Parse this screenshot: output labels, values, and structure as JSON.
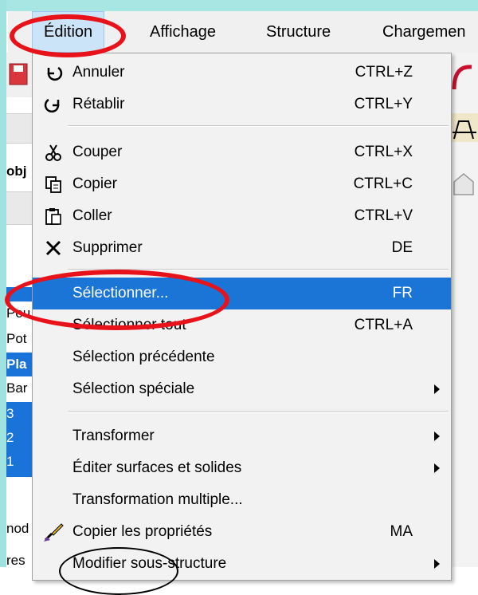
{
  "menubar": {
    "items": [
      {
        "label": "Édition"
      },
      {
        "label": "Affichage"
      },
      {
        "label": "Structure"
      },
      {
        "label": "Chargemen"
      }
    ]
  },
  "left_panel": {
    "labels": [
      "obj",
      "Pou",
      "Pot",
      "Pla",
      "Bar",
      "3",
      "2",
      "1",
      "nod",
      "res"
    ]
  },
  "menu": {
    "items": [
      {
        "label": "Annuler",
        "shortcut": "CTRL+Z",
        "icon": "undo-icon"
      },
      {
        "label": "Rétablir",
        "shortcut": "CTRL+Y",
        "icon": "redo-icon"
      },
      {
        "label": "Couper",
        "shortcut": "CTRL+X",
        "icon": "scissors-icon"
      },
      {
        "label": "Copier",
        "shortcut": "CTRL+C",
        "icon": "copy-icon"
      },
      {
        "label": "Coller",
        "shortcut": "CTRL+V",
        "icon": "paste-icon"
      },
      {
        "label": "Supprimer",
        "shortcut": "DE",
        "icon": "delete-x-icon"
      },
      {
        "label": "Sélectionner...",
        "shortcut": "FR"
      },
      {
        "label": "Sélectionner tout",
        "shortcut": "CTRL+A"
      },
      {
        "label": "Sélection précédente",
        "shortcut": ""
      },
      {
        "label": "Sélection spéciale",
        "shortcut": "",
        "submenu": true
      },
      {
        "label": "Transformer",
        "shortcut": "",
        "submenu": true
      },
      {
        "label": "Éditer surfaces et solides",
        "shortcut": "",
        "submenu": true
      },
      {
        "label": "Transformation multiple...",
        "shortcut": ""
      },
      {
        "label": "Copier les propriétés",
        "shortcut": "MA",
        "icon": "brush-icon"
      },
      {
        "label": "Modifier sous-structure",
        "shortcut": "",
        "submenu": true
      }
    ]
  },
  "colors": {
    "highlight": "#1b75d6",
    "annotation_red": "#e8121b",
    "menu_bg": "#f2f2f2"
  }
}
